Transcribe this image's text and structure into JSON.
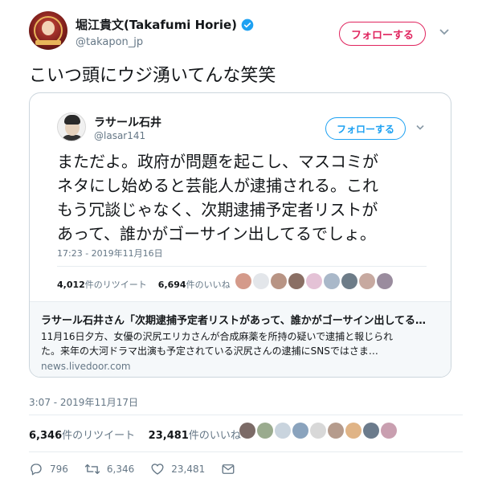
{
  "author": {
    "display_name": "堀江貴文(Takafumi Horie)",
    "handle": "@takapon_jp",
    "follow_label": "フォローする"
  },
  "tweet": {
    "text": "こいつ頭にウジ湧いてんな笑笑"
  },
  "quoted": {
    "display_name": "ラサール石井",
    "handle": "@lasar141",
    "follow_label": "フォローする",
    "lines": [
      "まただよ。政府が問題を起こし、マスコミが",
      "ネタにし始めると芸能人が逮捕される。これ",
      "もう冗談じゃなく、次期逮捕予定者リストが",
      "あって、誰かがゴーサイン出してるでしょ。"
    ],
    "timestamp": "17:23 - 2019年11月16日",
    "retweets_count": "4,012",
    "retweets_label": "件のリツイート",
    "likes_count": "6,694",
    "likes_label": "件のいいね"
  },
  "link_card": {
    "title": "ラサール石井さん「次期逮捕予定者リストがあって、誰かがゴーサイン出してる…",
    "desc_line1": "11月16日夕方、女優の沢尻エリカさんが合成麻薬を所持の疑いで逮捕と報じられ",
    "desc_line2": "た。来年の大河ドラマ出演も予定されている沢尻さんの逮捕にSNSではさま…",
    "domain": "news.livedoor.com"
  },
  "timestamp": "3:07 - 2019年11月17日",
  "stats": {
    "retweets_count": "6,346",
    "retweets_label": "件のリツイート",
    "likes_count": "23,481",
    "likes_label": "件のいいね"
  },
  "actions": {
    "replies": "796",
    "retweets": "6,346",
    "likes": "23,481"
  },
  "colors": {
    "follow_pink": "#e0245e",
    "follow_blue": "#1da1f2",
    "verified_blue": "#1da1f2",
    "muted_text": "#657786"
  },
  "icons": [
    "verified-icon",
    "chevron-down-icon",
    "reply-icon",
    "retweet-icon",
    "like-icon",
    "message-icon"
  ]
}
